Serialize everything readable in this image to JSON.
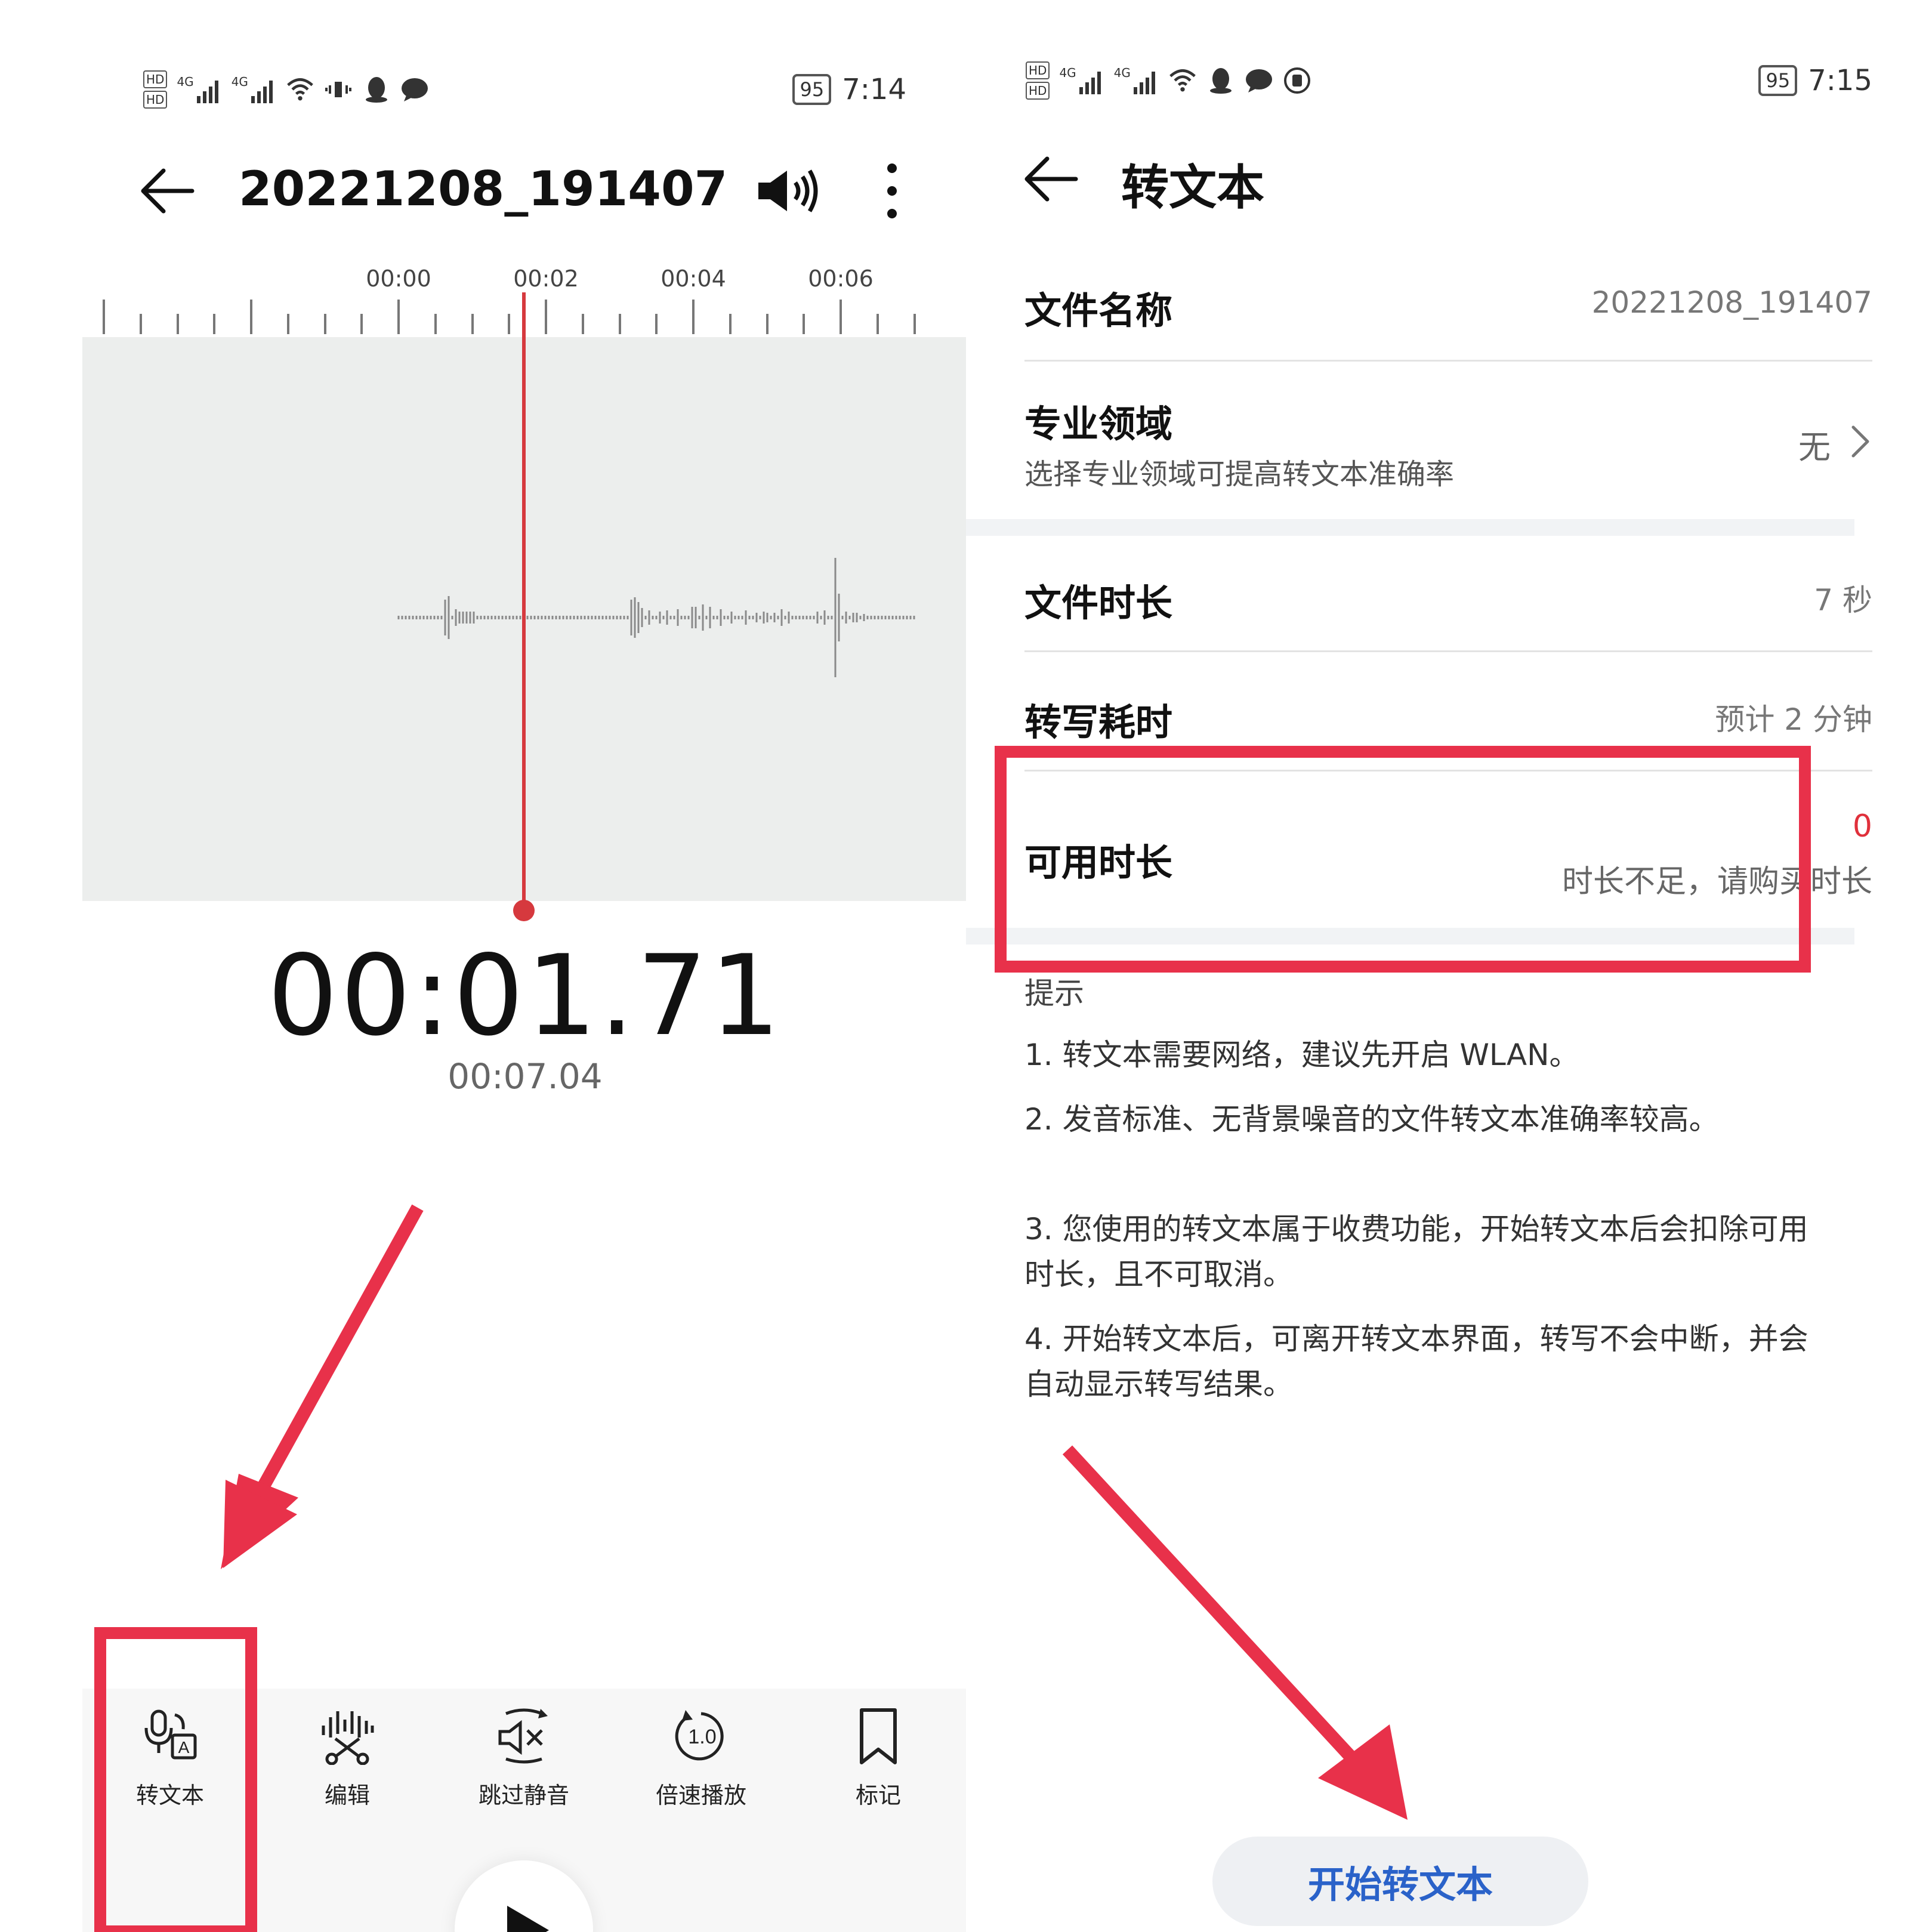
{
  "left": {
    "status_time": "7:14",
    "battery": "95",
    "network_label_1": "HD",
    "network_label_2": "HD",
    "signal_1": "4G",
    "signal_2": "4G",
    "title": "20221208_191407",
    "ruler_labels": [
      "00:00",
      "00:02",
      "00:04",
      "00:06"
    ],
    "current_time": "00:01.71",
    "total_time": "00:07.04",
    "tools": [
      {
        "label": "转文本",
        "icon": "speech-to-text-icon"
      },
      {
        "label": "编辑",
        "icon": "scissors-edit-icon"
      },
      {
        "label": "跳过静音",
        "icon": "skip-silence-icon"
      },
      {
        "label": "倍速播放",
        "icon": "playback-speed-icon"
      },
      {
        "label": "标记",
        "icon": "bookmark-icon"
      }
    ],
    "speed_value": "1.0"
  },
  "right": {
    "status_time": "7:15",
    "battery": "95",
    "network_label_1": "HD",
    "network_label_2": "HD",
    "signal_1": "4G",
    "signal_2": "4G",
    "title": "转文本",
    "file_name_label": "文件名称",
    "file_name_value": "20221208_191407",
    "domain_label": "专业领域",
    "domain_sub": "选择专业领域可提高转文本准确率",
    "domain_value": "无",
    "duration_label": "文件时长",
    "duration_value": "7 秒",
    "transcribe_time_label": "转写耗时",
    "transcribe_time_value": "预计 2 分钟",
    "available_label": "可用时长",
    "available_value": "0",
    "available_note": "时长不足，请购买时长",
    "tips_title": "提示",
    "tips": [
      "1. 转文本需要网络，建议先开启 WLAN。",
      "2. 发音标准、无背景噪音的文件转文本准确率较高。",
      "3. 您使用的转文本属于收费功能，开始转文本后会扣除可用时长，且不可取消。",
      "4. 开始转文本后，可离开转文本界面，转写不会中断，并会自动显示转写结果。"
    ],
    "start_button": "开始转文本"
  },
  "colors": {
    "accent_red": "#e8314a",
    "playhead": "#d6393e",
    "button_text": "#2a62c9",
    "warning_red": "#e0303b"
  }
}
